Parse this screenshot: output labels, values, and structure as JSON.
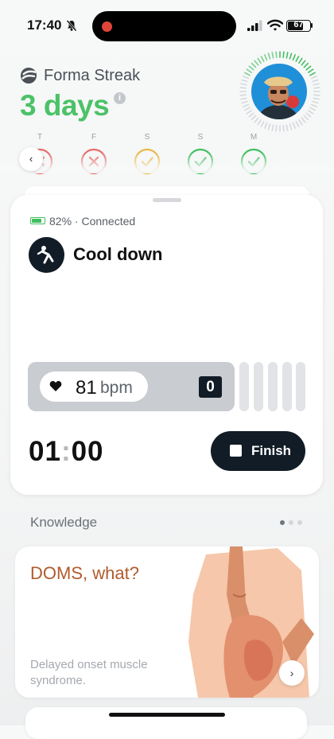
{
  "status_bar": {
    "time": "17:40",
    "battery": "67"
  },
  "header": {
    "brand": "Forma Streak",
    "streak": "3 days",
    "info_glyph": "i"
  },
  "week": [
    {
      "letter": "T",
      "status": "missed",
      "color": "#e86c6c"
    },
    {
      "letter": "F",
      "status": "missed",
      "color": "#e86c6c"
    },
    {
      "letter": "S",
      "status": "partial",
      "color": "#eab948"
    },
    {
      "letter": "S",
      "status": "done",
      "color": "#43c062"
    },
    {
      "letter": "M",
      "status": "done",
      "color": "#43c062"
    }
  ],
  "nav": {
    "back_glyph": "‹"
  },
  "workout": {
    "battery_status": "82% · Connected",
    "activity": "Cool down",
    "heart_rate": "81",
    "heart_rate_unit": "bpm",
    "zone": "0",
    "timer_minutes": "01",
    "timer_separator": ":",
    "timer_seconds": "00",
    "finish_label": "Finish"
  },
  "knowledge": {
    "title": "Knowledge",
    "pager": {
      "total": 3,
      "active": 0
    },
    "article": {
      "title": "DOMS, what?",
      "description": "Delayed onset muscle syndrome.",
      "next_glyph": "›"
    }
  },
  "colors": {
    "accent_green": "#4cc268",
    "dark": "#111c26",
    "article_title": "#b25a2c"
  }
}
